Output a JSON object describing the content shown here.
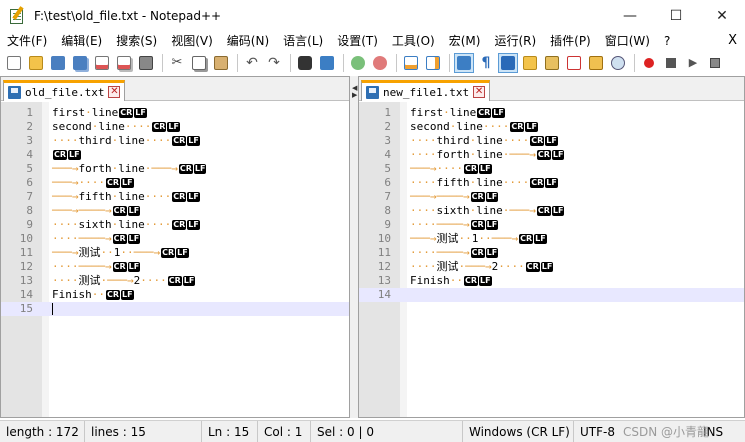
{
  "window": {
    "title": "F:\\test\\old_file.txt - Notepad++",
    "minimize": "—",
    "maximize": "☐",
    "close": "✕"
  },
  "menu": {
    "items": [
      "文件(F)",
      "编辑(E)",
      "搜索(S)",
      "视图(V)",
      "编码(N)",
      "语言(L)",
      "设置(T)",
      "工具(O)",
      "宏(M)",
      "运行(R)",
      "插件(P)",
      "窗口(W)",
      "?"
    ],
    "close_label": "X"
  },
  "toolbar": {
    "icons": [
      "new-file-icon",
      "open-file-icon",
      "save-icon",
      "save-all-icon",
      "close-icon",
      "close-all-icon",
      "print-icon",
      "cut-icon",
      "copy-icon",
      "paste-icon",
      "undo-icon",
      "redo-icon",
      "find-icon",
      "replace-icon",
      "zoom-in-icon",
      "zoom-out-icon",
      "sync-vertical-icon",
      "sync-horizontal-icon",
      "word-wrap-icon",
      "show-all-chars-icon",
      "indent-guide-icon",
      "udl-icon",
      "doc-map-icon",
      "function-list-icon",
      "folder-workspace-icon",
      "monitor-icon",
      "record-macro-icon",
      "stop-record-icon",
      "play-macro-icon",
      "run-macro-icon"
    ],
    "colors": {
      "accent": "#2f6fb3",
      "orange": "#f7a200",
      "red": "#cc2222",
      "green": "#3d9a3d"
    }
  },
  "left_pane": {
    "tab_label": "old_file.txt",
    "close_symbol": "✕",
    "lines": [
      {
        "n": "1",
        "text": "first·line",
        "eol": true
      },
      {
        "n": "2",
        "text": "second·line····",
        "eol": true
      },
      {
        "n": "3",
        "text": "····third·line····",
        "eol": true
      },
      {
        "n": "4",
        "text": "",
        "eol": true
      },
      {
        "n": "5",
        "text": "───→forth·line·───→",
        "eol": true
      },
      {
        "n": "6",
        "text": "───→····",
        "eol": true
      },
      {
        "n": "7",
        "text": "───→fifth·line····",
        "eol": true
      },
      {
        "n": "8",
        "text": "───→────→",
        "eol": true
      },
      {
        "n": "9",
        "text": "····sixth·line····",
        "eol": true
      },
      {
        "n": "10",
        "text": "····────→",
        "eol": true
      },
      {
        "n": "11",
        "text": "───→测试··1··───→",
        "eol": true
      },
      {
        "n": "12",
        "text": "····────→",
        "eol": true
      },
      {
        "n": "13",
        "text": "····测试·───→2····",
        "eol": true
      },
      {
        "n": "14",
        "text": "Finish··",
        "eol": true
      },
      {
        "n": "15",
        "text": "",
        "eol": false
      }
    ]
  },
  "right_pane": {
    "tab_label": "new_file1.txt",
    "close_symbol": "✕",
    "lines": [
      {
        "n": "1",
        "text": "first·line",
        "eol": true
      },
      {
        "n": "2",
        "text": "second·line····",
        "eol": true
      },
      {
        "n": "3",
        "text": "····third·line····",
        "eol": true
      },
      {
        "n": "4",
        "text": "····forth·line·───→",
        "eol": true
      },
      {
        "n": "5",
        "text": "───→····",
        "eol": true
      },
      {
        "n": "6",
        "text": "····fifth·line····",
        "eol": true
      },
      {
        "n": "7",
        "text": "───→────→",
        "eol": true
      },
      {
        "n": "8",
        "text": "····sixth·line·───→",
        "eol": true
      },
      {
        "n": "9",
        "text": "····────→",
        "eol": true
      },
      {
        "n": "10",
        "text": "───→测试··1··───→",
        "eol": true
      },
      {
        "n": "11",
        "text": "····────→",
        "eol": true
      },
      {
        "n": "12",
        "text": "····测试·───→2····",
        "eol": true
      },
      {
        "n": "13",
        "text": "Finish··",
        "eol": true
      },
      {
        "n": "14",
        "text": "",
        "eol": false
      }
    ]
  },
  "eol_marker": {
    "cr": "CR",
    "lf": "LF"
  },
  "status": {
    "length": "length : 172",
    "lines": "lines : 15",
    "ln": "Ln : 15",
    "col": "Col : 1",
    "sel": "Sel : 0 | 0",
    "eol": "Windows (CR LF)",
    "encoding": "UTF-8",
    "mode": "INS",
    "watermark": "CSDN @小青龍"
  }
}
